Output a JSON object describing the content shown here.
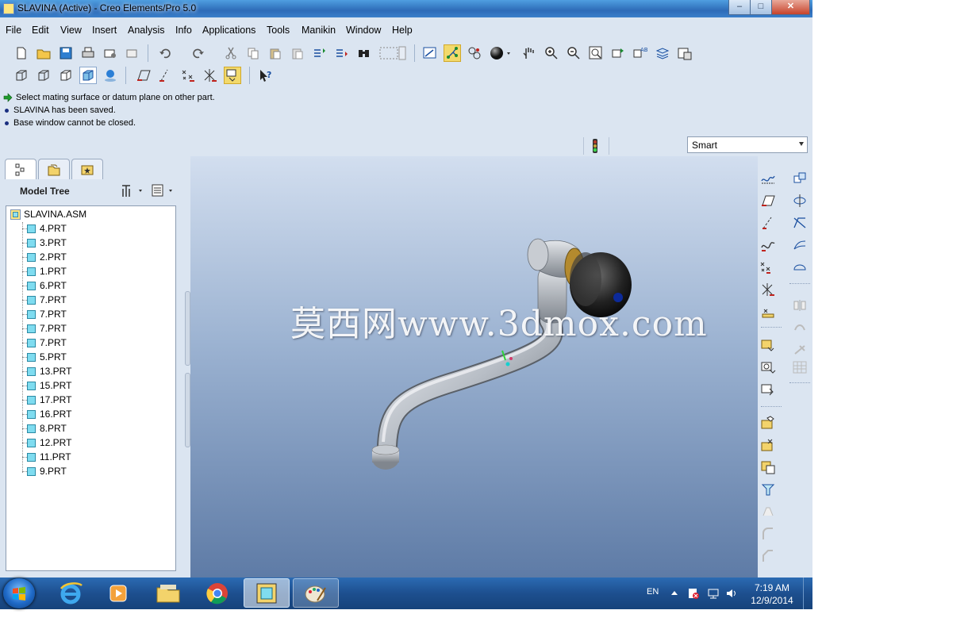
{
  "window": {
    "title": "SLAVINA (Active) - Creo Elements/Pro 5.0"
  },
  "menu": [
    "File",
    "Edit",
    "View",
    "Insert",
    "Analysis",
    "Info",
    "Applications",
    "Tools",
    "Manikin",
    "Window",
    "Help"
  ],
  "messages": [
    {
      "text": "Select mating surface or datum plane on other part.",
      "kind": "prompt"
    },
    {
      "text": "SLAVINA has been saved.",
      "kind": "info"
    },
    {
      "text": "Base window cannot be closed.",
      "kind": "info"
    }
  ],
  "filter": {
    "selected": "Smart"
  },
  "model_tree": {
    "title": "Model Tree",
    "root": "SLAVINA.ASM",
    "items": [
      "4.PRT",
      "3.PRT",
      "2.PRT",
      "1.PRT",
      "6.PRT",
      "7.PRT",
      "7.PRT",
      "7.PRT",
      "7.PRT",
      "5.PRT",
      "13.PRT",
      "15.PRT",
      "17.PRT",
      "16.PRT",
      "8.PRT",
      "12.PRT",
      "11.PRT",
      "9.PRT"
    ]
  },
  "viewport": {
    "watermark": "莫西网www.3dmox.com"
  },
  "taskbar": {
    "language": "EN",
    "time": "7:19 AM",
    "date": "12/9/2014",
    "apps": [
      "internet-explorer",
      "media-player",
      "file-explorer",
      "chrome",
      "creo",
      "paint"
    ]
  }
}
